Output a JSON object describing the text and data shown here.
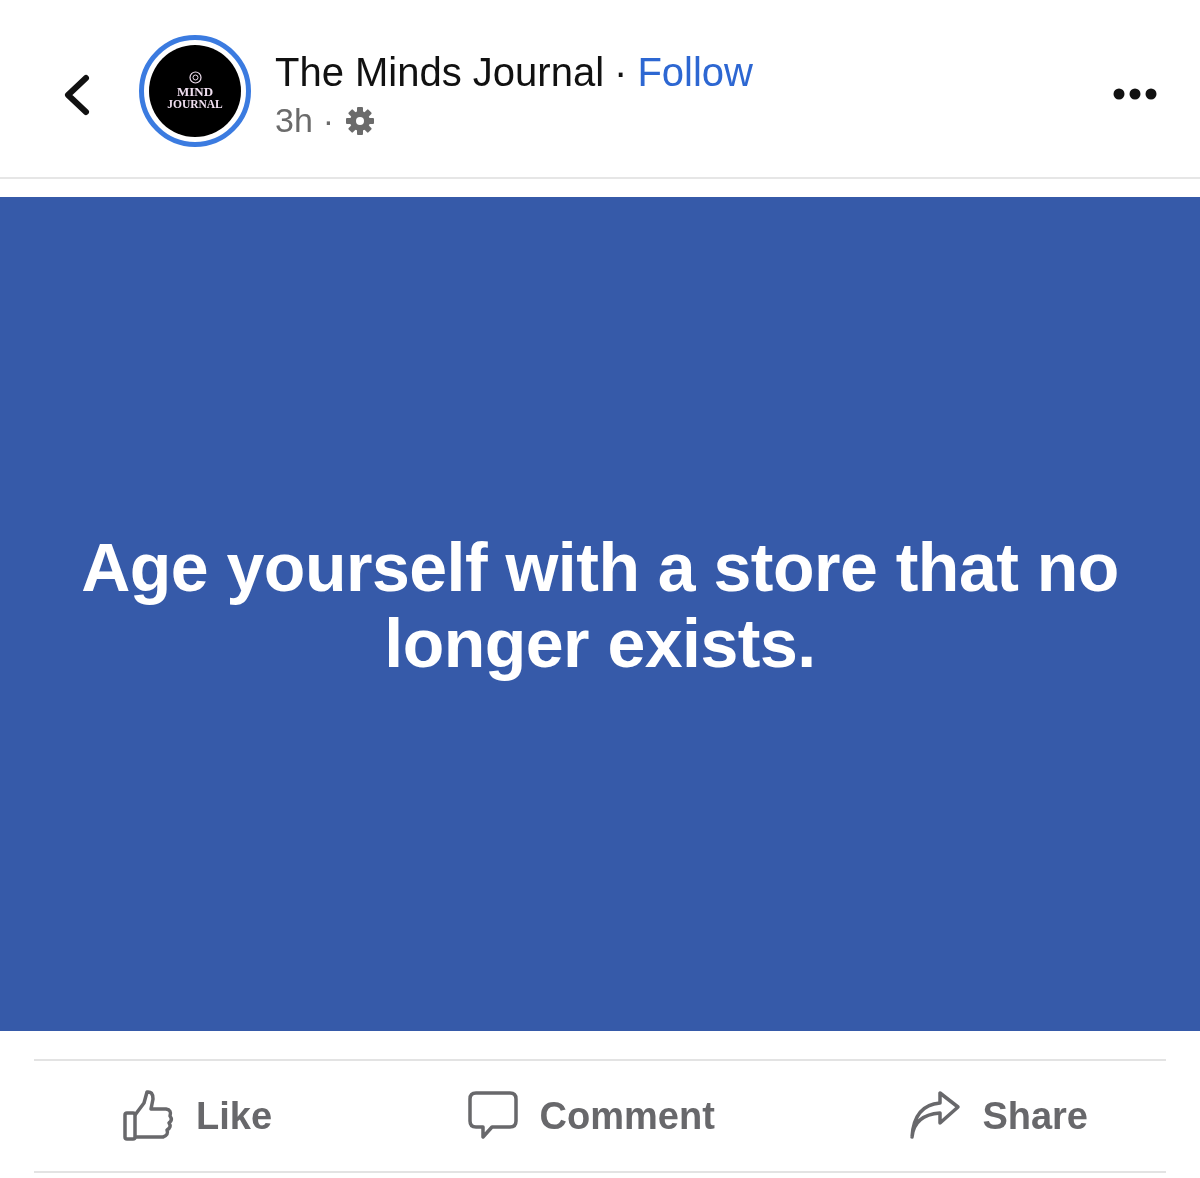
{
  "header": {
    "avatar_logo": [
      "MIND",
      "JOURNAL"
    ],
    "page_name": "The Minds Journal",
    "separator": "·",
    "follow": "Follow",
    "time": "3h",
    "time_separator": "·"
  },
  "post": {
    "text": "Age yourself with a store that no longer exists."
  },
  "actions": [
    {
      "kind": "like",
      "label": "Like"
    },
    {
      "kind": "comment",
      "label": "Comment"
    },
    {
      "kind": "share",
      "label": "Share"
    }
  ]
}
